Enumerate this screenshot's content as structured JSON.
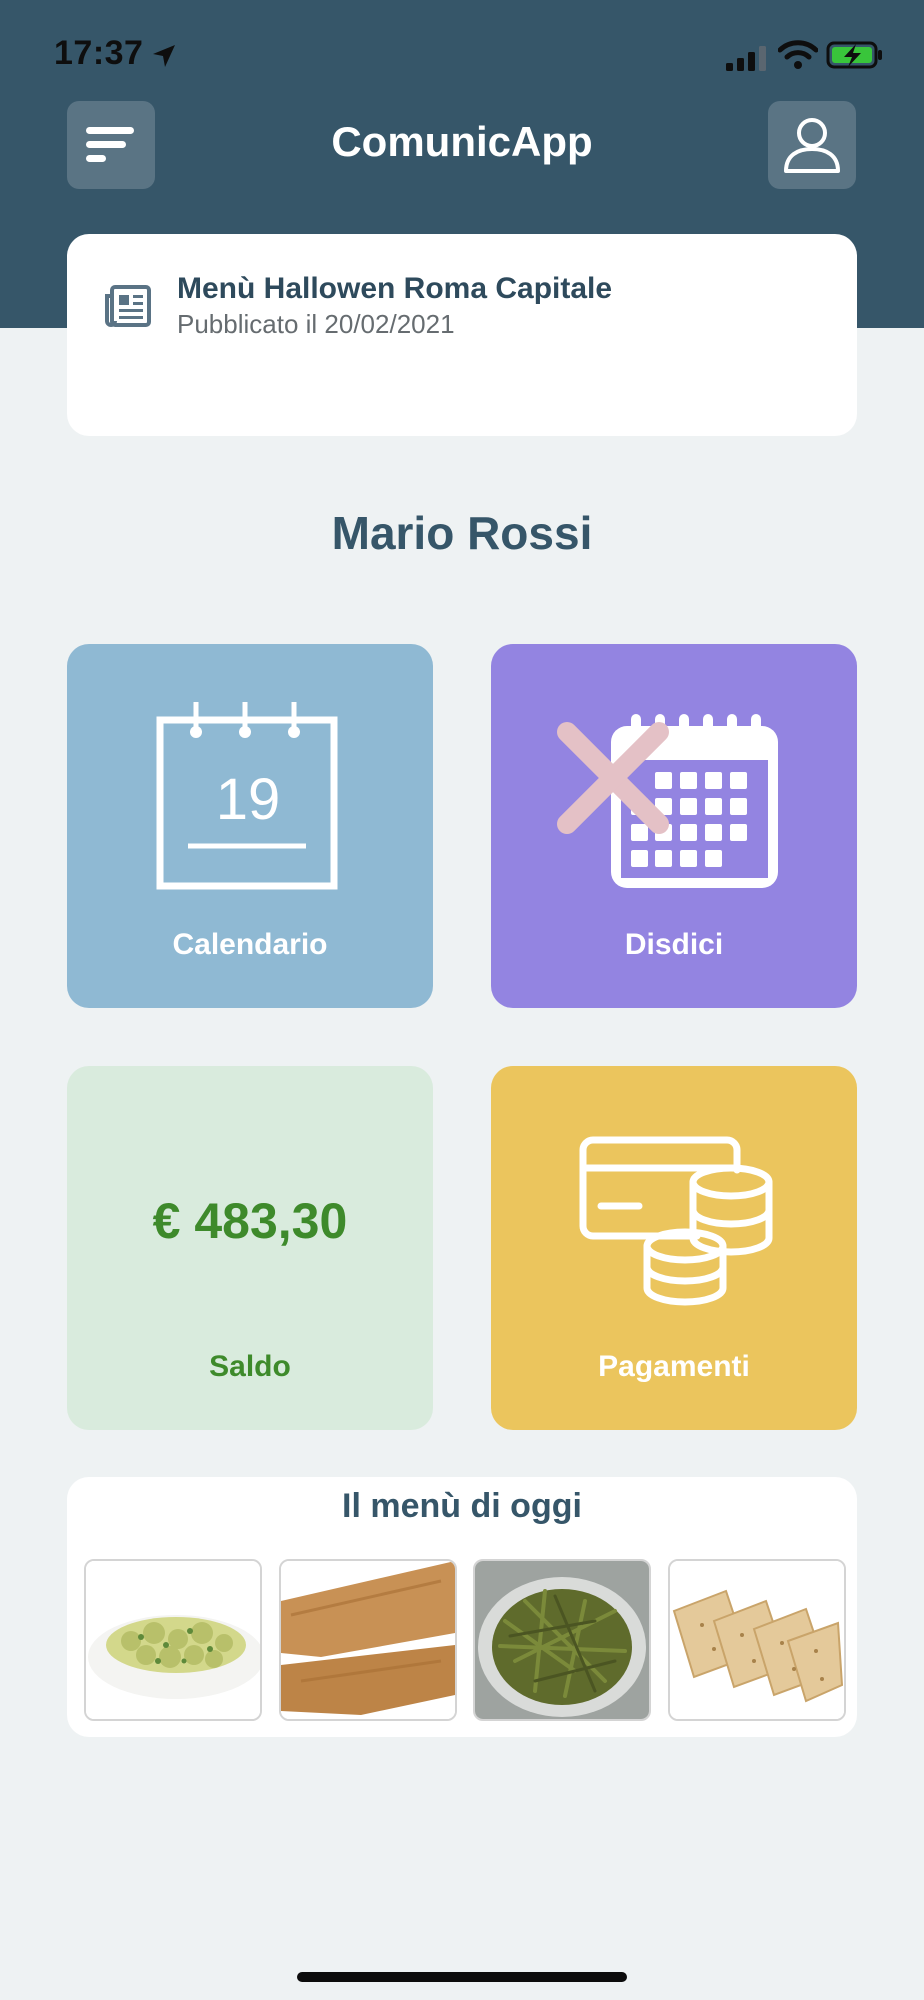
{
  "status_bar": {
    "time": "17:37"
  },
  "header": {
    "title": "ComunicApp"
  },
  "news": {
    "title": "Menù Hallowen Roma Capitale",
    "date": "Pubblicato il 20/02/2021"
  },
  "user": {
    "name": "Mario Rossi"
  },
  "tiles": {
    "calendar": {
      "label": "Calendario",
      "day": "19"
    },
    "cancel": {
      "label": "Disdici"
    },
    "balance": {
      "label": "Saldo",
      "amount": "€ 483,30"
    },
    "payments": {
      "label": "Pagamenti"
    }
  },
  "daily_menu": {
    "title": "Il menù di oggi",
    "items": [
      "orecchiette-pasta-image",
      "fish-fillet-image",
      "green-beans-image",
      "crackers-image"
    ]
  },
  "colors": {
    "header": "#365669",
    "calendar_tile": "#8fb9d3",
    "cancel_tile": "#9384e1",
    "balance_tile": "#d9ebdd",
    "payments_tile": "#ebc55d",
    "balance_text": "#3e8a2b"
  }
}
